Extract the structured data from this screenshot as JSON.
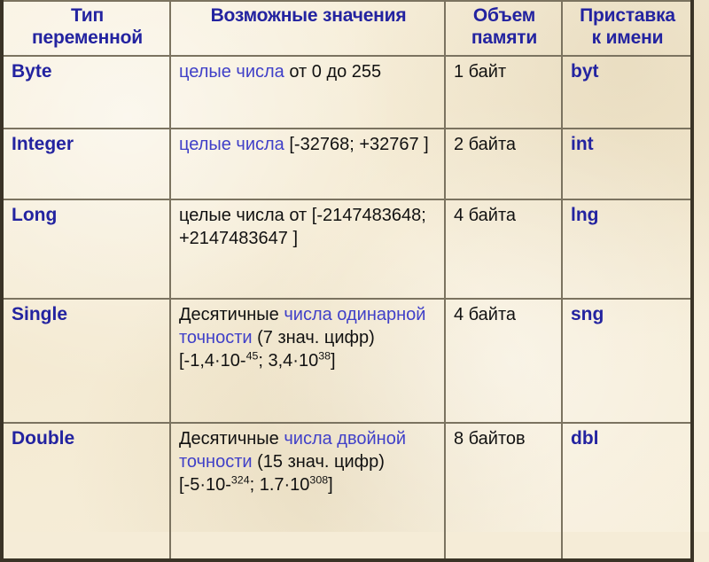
{
  "table": {
    "headers": [
      "Тип\nпеременной",
      "Возможные значения",
      "Объем\nпамяти",
      "Приставка\nк имени"
    ],
    "rows": [
      {
        "type": "Byte",
        "values_parts": [
          {
            "text": "целые числа ",
            "highlight": true
          },
          {
            "text": "от 0 до 255",
            "highlight": false
          }
        ],
        "values_plain": "целые числа от 0 до 255",
        "memory": "1 байт",
        "prefix": "byt"
      },
      {
        "type": "Integer",
        "values_parts": [
          {
            "text": "целые числа",
            "highlight": true
          },
          {
            "text": "\n[-32768; +32767 ]",
            "highlight": false
          }
        ],
        "values_plain": "целые числа [-32768; +32767 ]",
        "memory": "2 байта",
        "prefix": "int"
      },
      {
        "type": "Long",
        "values_parts": [
          {
            "text": "целые числа от [-2147483648; +2147483647 ]",
            "highlight": false
          }
        ],
        "values_plain": "целые числа от [-2147483648; +2147483647 ]",
        "memory": "4 байта",
        "prefix": "lng"
      },
      {
        "type": "Single",
        "values_parts": [
          {
            "text": "Десятичные ",
            "highlight": false
          },
          {
            "text": "числа одинарной точности ",
            "highlight": true
          },
          {
            "text": "(7 знач. цифр) [-1,4·10-",
            "highlight": false
          },
          {
            "text": "45",
            "highlight": false,
            "sup": true
          },
          {
            "text": "; 3,4·10",
            "highlight": false
          },
          {
            "text": "38",
            "highlight": false,
            "sup": true
          },
          {
            "text": "]",
            "highlight": false
          }
        ],
        "values_plain": "Десятичные числа одинарной точности (7 знач. цифр) [-1,4·10-45; 3,4·1038]",
        "memory": "4 байта",
        "prefix": "sng"
      },
      {
        "type": "Double",
        "values_parts": [
          {
            "text": "Десятичные ",
            "highlight": false
          },
          {
            "text": "числа двойной точности ",
            "highlight": true
          },
          {
            "text": "(15 знач. цифр) [-5·10-",
            "highlight": false
          },
          {
            "text": "324",
            "highlight": false,
            "sup": true
          },
          {
            "text": "; 1.7·10",
            "highlight": false
          },
          {
            "text": "308",
            "highlight": false,
            "sup": true
          },
          {
            "text": "]",
            "highlight": false
          }
        ],
        "values_plain": "Десятичные числа двойной точности (15 знач. цифр) [-5·10-324; 1.7·10308]",
        "memory": "8 байтов",
        "prefix": "dbl"
      }
    ]
  },
  "colors": {
    "accent_blue": "#2323a0",
    "highlight_blue": "#4040c8",
    "text_black": "#111111",
    "background": "#f4ead2",
    "border_outer": "#3a3326",
    "border_inner": "#7b7360"
  }
}
